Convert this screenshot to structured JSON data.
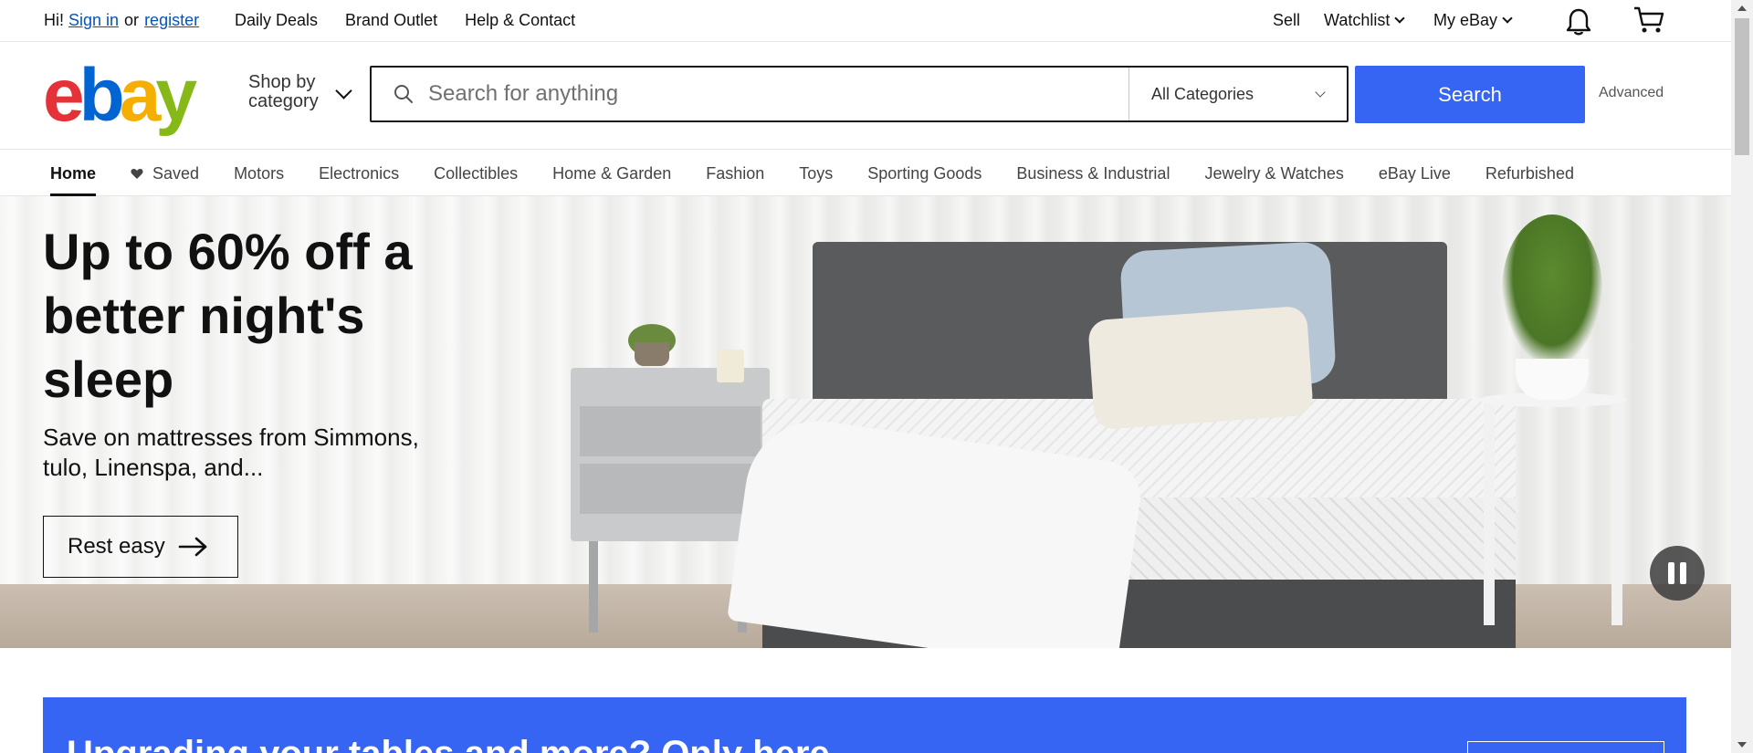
{
  "topbar": {
    "greeting": "Hi!",
    "sign_in": "Sign in",
    "or": "or",
    "register": "register",
    "links": [
      "Daily Deals",
      "Brand Outlet",
      "Help & Contact"
    ],
    "sell": "Sell",
    "watchlist": "Watchlist",
    "my_ebay": "My eBay",
    "icons": [
      "bell-icon",
      "cart-icon"
    ]
  },
  "header": {
    "logo": {
      "e": "e",
      "b": "b",
      "a": "a",
      "y": "y"
    },
    "shop_by_line1": "Shop by",
    "shop_by_line2": "category",
    "search_placeholder": "Search for anything",
    "search_value": "",
    "category_selected": "All Categories",
    "search_button": "Search",
    "advanced": "Advanced"
  },
  "nav": {
    "tabs": [
      "Home",
      "Saved",
      "Motors",
      "Electronics",
      "Collectibles",
      "Home & Garden",
      "Fashion",
      "Toys",
      "Sporting Goods",
      "Business & Industrial",
      "Jewelry & Watches",
      "eBay Live",
      "Refurbished"
    ],
    "active": "Home"
  },
  "hero": {
    "title": "Up to 60% off a better night's sleep",
    "subtitle": "Save on mattresses from Simmons, tulo, Linenspa, and...",
    "cta": "Rest easy"
  },
  "banner": {
    "text": "Upgrading your tables and more? Only here..."
  },
  "colors": {
    "accent": "#3665f3",
    "link": "#0654ba",
    "logo_red": "#e53238",
    "logo_blue": "#0064d2",
    "logo_yellow": "#f5af02",
    "logo_green": "#86b817"
  }
}
